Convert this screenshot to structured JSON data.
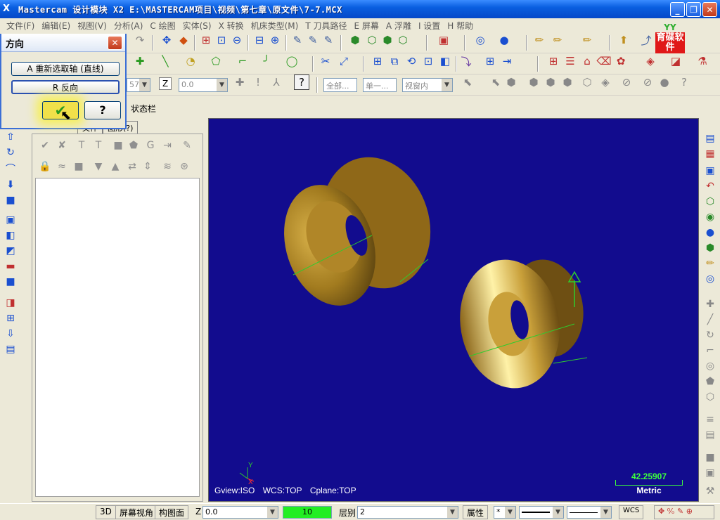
{
  "window": {
    "title": "Mastercam 设计模块  X2  E:\\MASTERCAM项目\\视频\\第七章\\原文件\\7-7.MCX",
    "app_icon": "X"
  },
  "menu": [
    "文件(F)",
    "编辑(E)",
    "视图(V)",
    "分析(A)",
    "C 绘图",
    "实体(S)",
    "X 转换",
    "机床类型(M)",
    "T 刀具路径",
    "E 屏幕",
    "A 浮雕",
    "I 设置",
    "H 帮助"
  ],
  "toolbar2": {
    "z_label": "Z",
    "z_value": "0.0",
    "partial_value": "57",
    "all_btn": "全部...",
    "single_btn": "单一...",
    "view_combo": "视窗内"
  },
  "logo": {
    "mark": "YY",
    "text": "育碟软件"
  },
  "dialog": {
    "title": "方向",
    "btn_reselect": "A 重新选取轴 (直线)",
    "btn_reverse": "R 反向",
    "ok_symbol": "✔",
    "help_symbol": "?"
  },
  "status_label": "状态栏",
  "ops_tabs": [
    "文件",
    "图形(?)"
  ],
  "viewport": {
    "gview": "Gview:ISO",
    "wcs": "WCS:TOP",
    "cplane": "Cplane:TOP",
    "scale_value": "42.25907",
    "scale_unit": "Metric",
    "axis_y": "Y",
    "axis_x": "X",
    "bg_color": "#120c8e",
    "part_color": "#b8912c"
  },
  "bottom": {
    "btn_3d": "3D",
    "screen_view": "屏幕视角",
    "cplane_btn": "构图面",
    "z_label": "Z",
    "z_value": "0.0",
    "color_value": "10",
    "level_label": "层别",
    "level_value": "2",
    "attr_btn": "属性",
    "wcs_btn": "WCS"
  }
}
